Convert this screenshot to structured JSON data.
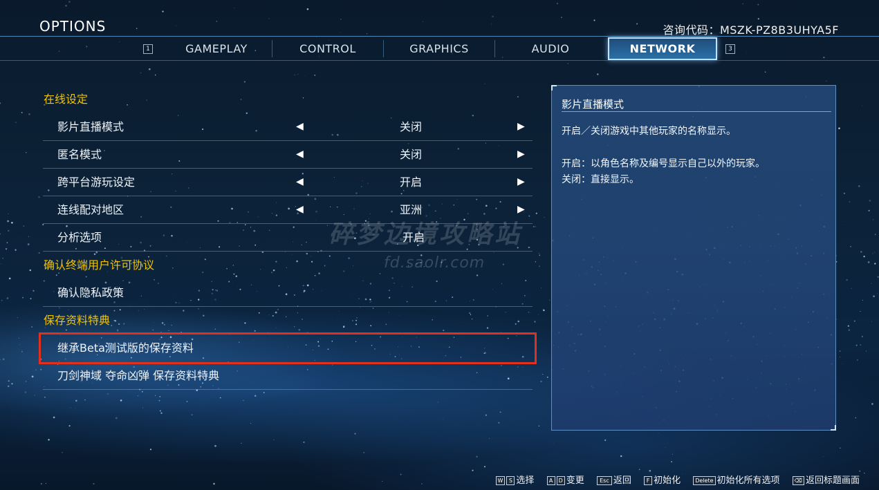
{
  "header": {
    "title": "OPTIONS",
    "inquiry_code": "咨询代码：MSZK-PZ8B3UHYA5F"
  },
  "tabs": {
    "prev_key": "1",
    "next_key": "3",
    "items": [
      "GAMEPLAY",
      "CONTROL",
      "GRAPHICS",
      "AUDIO",
      "NETWORK"
    ],
    "active": "NETWORK"
  },
  "sections": [
    {
      "title": "在线设定",
      "rows": [
        {
          "label": "影片直播模式",
          "value": "关闭",
          "arrows": true
        },
        {
          "label": "匿名模式",
          "value": "关闭",
          "arrows": true
        },
        {
          "label": "跨平台游玩设定",
          "value": "开启",
          "arrows": true
        },
        {
          "label": "连线配对地区",
          "value": "亚洲",
          "arrows": true
        },
        {
          "label": "分析选项",
          "value": "开启",
          "arrows": false
        }
      ]
    },
    {
      "title": "确认终端用户许可协议",
      "rows": [
        {
          "label": "确认隐私政策"
        }
      ]
    },
    {
      "title": "保存资料特典",
      "rows": [
        {
          "label": "继承Beta测试版的保存资料",
          "highlighted": true
        },
        {
          "label": "刀剑神域 夺命凶弹 保存资料特典"
        }
      ]
    }
  ],
  "arrow_glyphs": {
    "left": "◀",
    "right": "▶"
  },
  "info_panel": {
    "title": "影片直播模式",
    "line1": "开启／关闭游戏中其他玩家的名称显示。",
    "line2": "开启：以角色名称及编号显示自己以外的玩家。",
    "line3": "关闭：直接显示。"
  },
  "watermark": {
    "text": "碎梦边境攻略站",
    "url": "fd.saolr.com"
  },
  "footer": {
    "hints": [
      {
        "keys": [
          "W",
          "S"
        ],
        "label": "选择"
      },
      {
        "keys": [
          "A",
          "D"
        ],
        "label": "变更"
      },
      {
        "keys": [
          "Esc"
        ],
        "label": "返回"
      },
      {
        "keys": [
          "F"
        ],
        "label": "初始化"
      },
      {
        "keys": [
          "Delete"
        ],
        "label": "初始化所有选项"
      },
      {
        "keys": [
          "⌫"
        ],
        "label": "返回标题画面"
      }
    ]
  },
  "colors": {
    "section_title": "#f2c300",
    "highlight_outline": "#e1301c",
    "active_tab_border": "#bfe2ff",
    "panel_bg": "#264e80"
  }
}
